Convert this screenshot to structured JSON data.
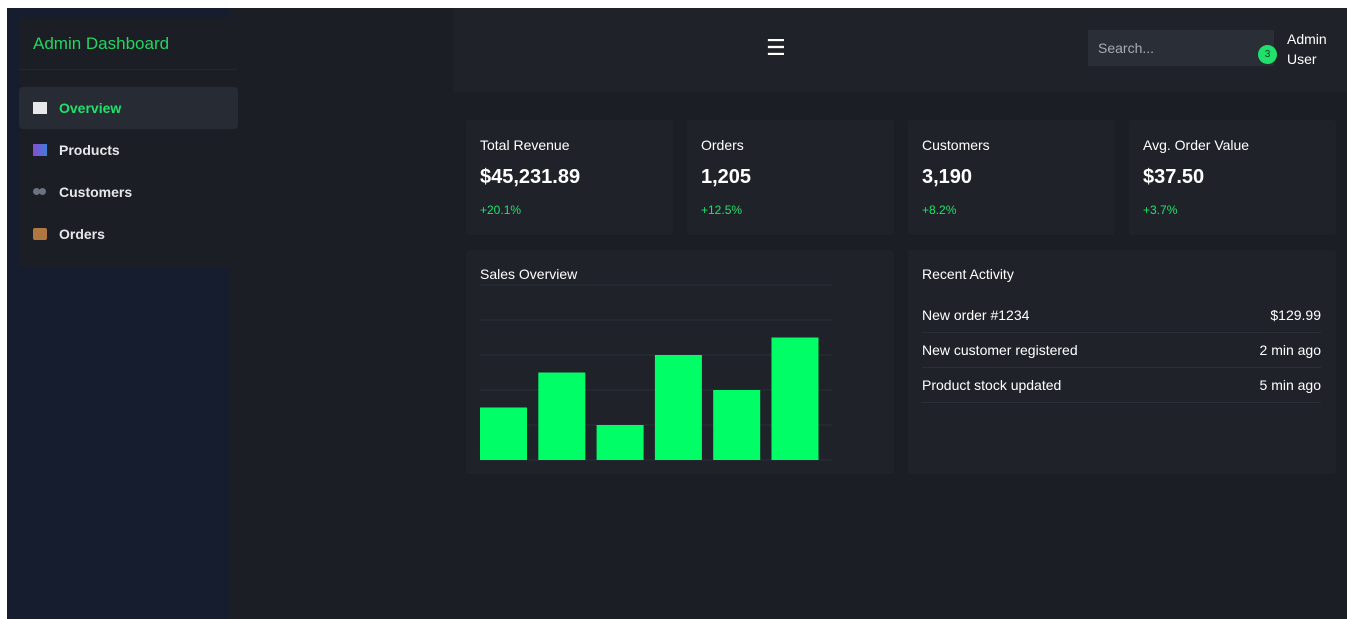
{
  "sidebar": {
    "brand": "Admin Dashboard",
    "items": [
      {
        "label": "Overview",
        "icon": "bar-chart-icon",
        "active": true
      },
      {
        "label": "Products",
        "icon": "box-icon",
        "active": false
      },
      {
        "label": "Customers",
        "icon": "users-icon",
        "active": false
      },
      {
        "label": "Orders",
        "icon": "package-icon",
        "active": false
      }
    ]
  },
  "header": {
    "menu_glyph": "☰",
    "search_placeholder": "Search...",
    "notification_count": "3",
    "user_line1": "Admin",
    "user_line2": "User"
  },
  "stats": [
    {
      "label": "Total Revenue",
      "value": "$45,231.89",
      "delta": "+20.1%"
    },
    {
      "label": "Orders",
      "value": "1,205",
      "delta": "+12.5%"
    },
    {
      "label": "Customers",
      "value": "3,190",
      "delta": "+8.2%"
    },
    {
      "label": "Avg. Order Value",
      "value": "$37.50",
      "delta": "+3.7%"
    }
  ],
  "sales": {
    "title": "Sales Overview"
  },
  "chart_data": {
    "type": "bar",
    "title": "Sales Overview",
    "categories": [
      "",
      "",
      "",
      "",
      "",
      ""
    ],
    "values": [
      30,
      50,
      20,
      60,
      40,
      70
    ],
    "ylim": [
      0,
      100
    ],
    "grid": true,
    "bar_color": "#00ff66"
  },
  "activity": {
    "title": "Recent Activity",
    "items": [
      {
        "text": "New order #1234",
        "meta": "$129.99"
      },
      {
        "text": "New customer registered",
        "meta": "2 min ago"
      },
      {
        "text": "Product stock updated",
        "meta": "5 min ago"
      }
    ]
  },
  "colors": {
    "accent": "#22e06a",
    "background": "#1b1e24",
    "card": "#1f2229",
    "sidebar_bg": "#151d2e"
  }
}
